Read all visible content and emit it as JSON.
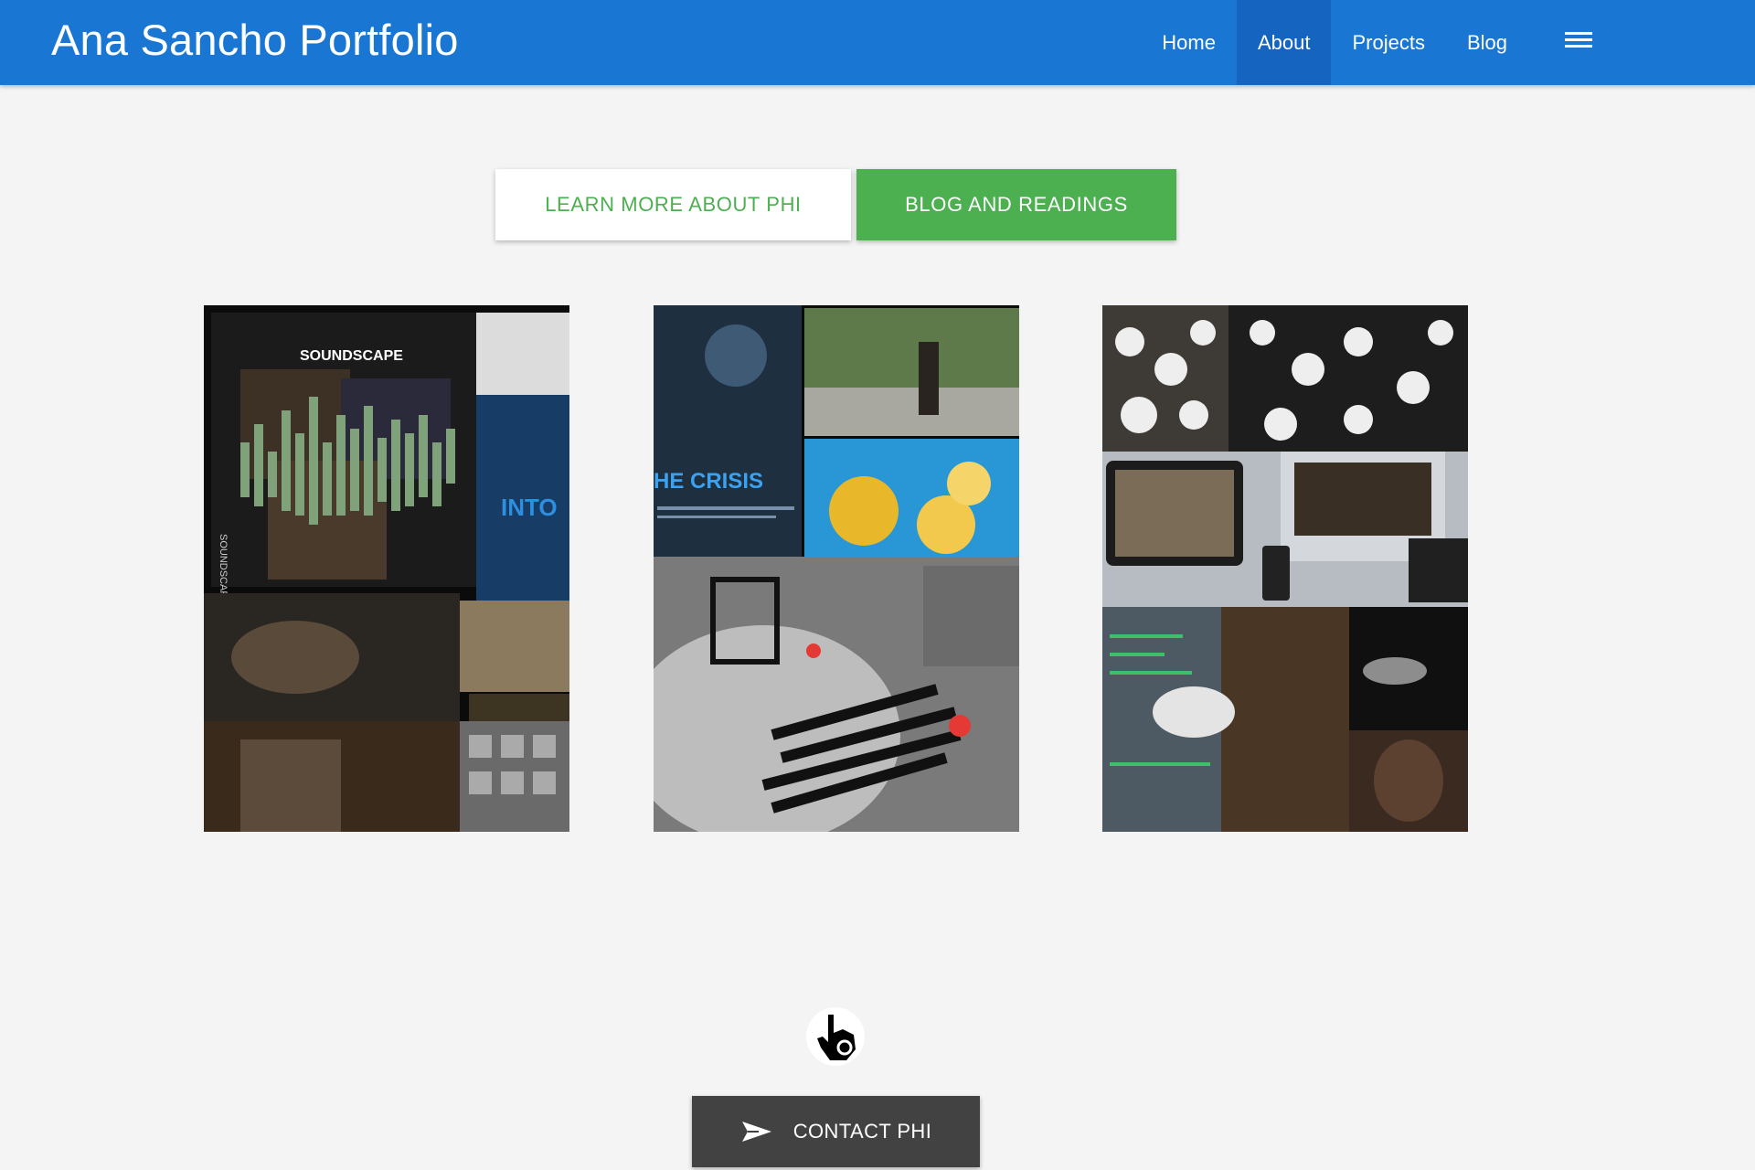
{
  "header": {
    "brand": "Ana Sancho Portfolio",
    "nav": [
      {
        "label": "Home",
        "active": false
      },
      {
        "label": "About",
        "active": true
      },
      {
        "label": "Projects",
        "active": false
      },
      {
        "label": "Blog",
        "active": false
      }
    ],
    "menu_icon": "hamburger-menu-icon",
    "bar_color": "#1976d2"
  },
  "actions": {
    "learn_more": "LEARN MORE ABOUT PHI",
    "blog": "BLOG AND READINGS",
    "accent": "#4caf50"
  },
  "gallery": {
    "card1": {
      "text_top": "SOUNDSCAPE",
      "text_side": "SOUNDSCAPE",
      "text_into": "INTO"
    },
    "card2": {
      "text_crisis": "HE CRISIS"
    },
    "card3": {}
  },
  "footer": {
    "hand_icon": "pointing-hand-icon",
    "contact": "CONTACT PHI",
    "send_icon": "send-icon"
  }
}
